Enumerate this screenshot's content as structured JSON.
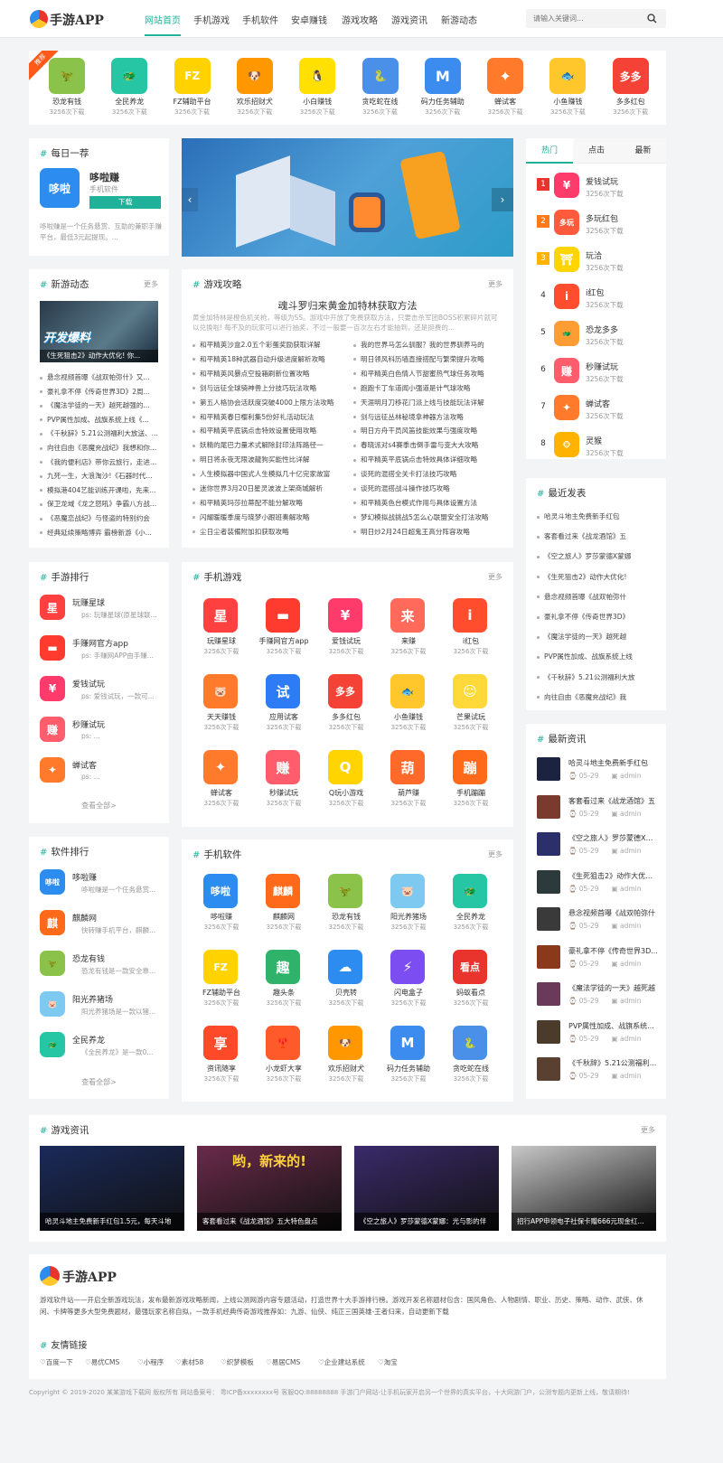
{
  "header": {
    "logo": "手游APP",
    "nav": [
      "网站首页",
      "手机游戏",
      "手机软件",
      "安卓赚钱",
      "游戏攻略",
      "游戏资讯",
      "新游动态"
    ],
    "search_placeholder": "请输入关键词...",
    "accent": "#1fb19a"
  },
  "top_apps": {
    "badge": "推荐",
    "items": [
      {
        "name": "恐龙有钱",
        "count": "3256次下载",
        "color": "#8bc34a",
        "glyph": "🦖"
      },
      {
        "name": "全民养龙",
        "count": "3256次下载",
        "color": "#26c6a5",
        "glyph": "🐲"
      },
      {
        "name": "FZ辅助平台",
        "count": "3256次下载",
        "color": "#ffd200",
        "glyph": "FZ"
      },
      {
        "name": "欢乐招财犬",
        "count": "3256次下载",
        "color": "#ff9800",
        "glyph": "🐶"
      },
      {
        "name": "小白赚钱",
        "count": "3256次下载",
        "color": "#ffe000",
        "glyph": "🐧"
      },
      {
        "name": "贪吃蛇在线",
        "count": "3256次下载",
        "color": "#4a8fe8",
        "glyph": "🐍"
      },
      {
        "name": "码力任务辅助",
        "count": "3256次下载",
        "color": "#3c8cf0",
        "glyph": "M"
      },
      {
        "name": "蝉试客",
        "count": "3256次下载",
        "color": "#ff7a2a",
        "glyph": "✦"
      },
      {
        "name": "小鱼赚钱",
        "count": "3256次下载",
        "color": "#ffc72c",
        "glyph": "🐟"
      },
      {
        "name": "多多红包",
        "count": "3256次下载",
        "color": "#f44336",
        "glyph": "多多"
      }
    ]
  },
  "daily": {
    "title": "每日一荐",
    "app_name": "哆啦赚",
    "app_type": "手机软件",
    "app_glyph": "哆啦",
    "download": "下载",
    "desc": "哆啦赚是一个任务悬赏、互助的兼职手赚平台，最低3元起提现。..."
  },
  "hot_tabs": [
    "热门",
    "点击",
    "最新"
  ],
  "hot_list": [
    {
      "rank": "1",
      "name": "爱钱试玩",
      "count": "3256次下载",
      "color": "#ff3b6b",
      "glyph": "¥"
    },
    {
      "rank": "2",
      "name": "多玩红包",
      "count": "3256次下载",
      "color": "#ff5a3c",
      "glyph": "多玩"
    },
    {
      "rank": "3",
      "name": "玩洽",
      "count": "3256次下载",
      "color": "#ffd400",
      "glyph": "⛩"
    },
    {
      "rank": "4",
      "name": "i红包",
      "count": "3256次下载",
      "color": "#ff4d2e",
      "glyph": "i"
    },
    {
      "rank": "5",
      "name": "恐龙多多",
      "count": "3256次下载",
      "color": "#ff9c33",
      "glyph": "🐲"
    },
    {
      "rank": "6",
      "name": "秒赚试玩",
      "count": "3256次下载",
      "color": "#ff5c6c",
      "glyph": "赚"
    },
    {
      "rank": "7",
      "name": "蝉试客",
      "count": "3256次下载",
      "color": "#ff7a2a",
      "glyph": "✦"
    },
    {
      "rank": "8",
      "name": "灵猴",
      "count": "3256次下载",
      "color": "#ffb300",
      "glyph": "🐵"
    }
  ],
  "news_dyn": {
    "title": "新游动态",
    "more": "更多",
    "img_caption": "《生死狙击2》动作大优化! 你...",
    "img_text": "开发爆料",
    "items": [
      "悬念视频首曝《战双帕弥什》又...",
      "豪礼拿不停《传奇世界3D》2周...",
      "《魔法学徒的一天》越死越强的...",
      "PVP属性加成、战旗系统上线《...",
      "《千秋辞》5.21公测福利大放送、...",
      "向往自由《恶魔充战纪》我想和你...",
      "《我的便利店》带你云旅行，走进...",
      "九死一生，大浪淘沙!《石器时代...",
      "模拟港404艺能训练开课啦，先来...",
      "保卫龙域《龙之怒吼》争霸八方战...",
      "《恶魔恋战纪》与怪盗的特别约会",
      "经典延续策略博弈 霸榜新游《小..."
    ]
  },
  "guides": {
    "title": "游戏攻略",
    "more": "更多",
    "headline": "魂斗罗归来黄金加特林获取方法",
    "summary": "黄金加特林是橙色机关枪，等级为SS。游戏中开放了免费获取方法，只要击杀军团BOSS积累碎片就可以兑换啦! 每不及的玩家可以进行抽奖，不过一般要一百次左右才能抽到，还是挺费的...",
    "left": [
      "和平精英沙盒2.0五个彩蛋奖励获取详解",
      "和平精英18种武器自动升级进度解析攻略",
      "和平精英风暴点空投箱刷新位置攻略",
      "剑与远征全球骑神兽上分技巧玩法攻略",
      "第五人格协会活跃度突破4000上限方法攻略",
      "和平精英春日樱利集5份好礼活动玩法",
      "和平精英平底锅点击特效设置使用攻略",
      "妖精的尾巴力量术式解除封印法阵路径一",
      "明日将永夜无限波龍狗买能性比详解",
      "人生模拟器中国式人生模拟几十亿完家故富",
      "迷你世界3月20日星灵波波上架商城解析",
      "和平精英玛莎拉蒂配不能分解攻略",
      "闪耀暖暖季度与晓梦小跟班奏解攻略",
      "尘日尘者装備附加扣获取攻略"
    ],
    "right": [
      "我的世界马怎么驯服？我的世界驯养马的",
      "明日领风科历墙直接搭配与繁荣提升攻略",
      "和平精英白色情人节甜蜜热气球任务攻略",
      "跑跑卡丁车道闻小强道是计气球攻略",
      "天涯明月刀移花门派上线与技能玩法详解",
      "剑与远征丛林秘境拿神器方法攻略",
      "明日方舟干员风笛技能效果与强度攻略",
      "春晓派对s4赛季击倒手雷与变大大攻略",
      "和平精英平底锅点击特效具体详细攻略",
      "谈死的混搭全关卡打法技巧攻略",
      "谈死的混搭战斗操作技巧攻略",
      "和平精英色台模式作用与具体设置方法",
      "梦幻模拟战挑战5怎么心联盟安全打法攻略",
      "明日炒2月24日超鬼王高分阵容攻略"
    ]
  },
  "latest": {
    "title": "最近发表",
    "items": [
      "哈灵斗地主免费新手红包",
      "客套看过来《战龙酒馆》五",
      "《空之旅人》罗莎蒙德X蒙娜",
      "《生死狙击2》动作大优化!",
      "悬念视频首曝《战双帕弥什",
      "豪礼拿不停《传奇世界3D》",
      "《魔法学徒的一天》越死越",
      "PVP属性加成、战旗系统上线",
      "《千秋辞》5.21公测福利大放",
      "向往自由《恶魔充战纪》我"
    ]
  },
  "news_info": {
    "title": "最新资讯",
    "items": [
      {
        "title": "哈灵斗地主免费新手红包",
        "date": "05-29",
        "author": "admin",
        "color": "#1b2340"
      },
      {
        "title": "客套看过来《战龙酒馆》五",
        "date": "05-29",
        "author": "admin",
        "color": "#7a3b2e"
      },
      {
        "title": "《空之旅人》罗莎蒙德X蒙...",
        "date": "05-29",
        "author": "admin",
        "color": "#2b2f6a"
      },
      {
        "title": "《生死狙击2》动作大优化...",
        "date": "05-29",
        "author": "admin",
        "color": "#2d3a3c"
      },
      {
        "title": "悬念视频首曝《战双帕弥什",
        "date": "05-29",
        "author": "admin",
        "color": "#3a3a3a"
      },
      {
        "title": "豪礼拿不停《传奇世界3D...",
        "date": "05-29",
        "author": "admin",
        "color": "#8a3a1a"
      },
      {
        "title": "《魔法学徒的一天》越死越",
        "date": "05-29",
        "author": "admin",
        "color": "#6a3a5a"
      },
      {
        "title": "PVP属性加成、战旗系统...",
        "date": "05-29",
        "author": "admin",
        "color": "#4a3b2a"
      },
      {
        "title": "《千秋辞》5.21公测福利...",
        "date": "05-29",
        "author": "admin",
        "color": "#5a4030"
      }
    ]
  },
  "game_rank": {
    "title": "手游排行",
    "view_all": "查看全部>",
    "items": [
      {
        "name": "玩赚星球",
        "ps": "ps: 玩赚星球(原星球联...",
        "color": "#ff4040",
        "glyph": "星"
      },
      {
        "name": "手赚网官方app",
        "ps": "ps: 手赚网APP由手赚...",
        "color": "#ff3b30",
        "glyph": "▬"
      },
      {
        "name": "爱钱试玩",
        "ps": "ps: 爱钱试玩，一款可...",
        "color": "#ff3b6b",
        "glyph": "¥"
      },
      {
        "name": "秒赚试玩",
        "ps": "ps: ...",
        "color": "#ff5c6c",
        "glyph": "赚"
      },
      {
        "name": "蝉试客",
        "ps": "ps: ...",
        "color": "#ff7a2a",
        "glyph": "✦"
      }
    ]
  },
  "phone_games": {
    "title": "手机游戏",
    "more": "更多",
    "items": [
      {
        "name": "玩赚星球",
        "count": "3256次下载",
        "color": "#ff4040",
        "glyph": "星"
      },
      {
        "name": "手赚网官方app",
        "count": "3256次下载",
        "color": "#ff3b30",
        "glyph": "▬"
      },
      {
        "name": "爱钱试玩",
        "count": "3256次下载",
        "color": "#ff3b6b",
        "glyph": "¥"
      },
      {
        "name": "来赚",
        "count": "3256次下载",
        "color": "#ff6a5a",
        "glyph": "来"
      },
      {
        "name": "i红包",
        "count": "3256次下载",
        "color": "#ff4d2e",
        "glyph": "i"
      },
      {
        "name": "天天赚钱",
        "count": "3256次下载",
        "color": "#ff7a2a",
        "glyph": "🐷"
      },
      {
        "name": "应用试客",
        "count": "3256次下载",
        "color": "#2d7cf6",
        "glyph": "试"
      },
      {
        "name": "多多红包",
        "count": "3256次下载",
        "color": "#f44336",
        "glyph": "多多"
      },
      {
        "name": "小鱼赚钱",
        "count": "3256次下载",
        "color": "#ffc72c",
        "glyph": "🐟"
      },
      {
        "name": "芒果试玩",
        "count": "3256次下载",
        "color": "#ffd93a",
        "glyph": "☺"
      },
      {
        "name": "蝉试客",
        "count": "3256次下载",
        "color": "#ff7a2a",
        "glyph": "✦"
      },
      {
        "name": "秒赚试玩",
        "count": "3256次下载",
        "color": "#ff5c6c",
        "glyph": "赚"
      },
      {
        "name": "Q玩小游戏",
        "count": "3256次下载",
        "color": "#ffd400",
        "glyph": "Q"
      },
      {
        "name": "葫芦赚",
        "count": "3256次下载",
        "color": "#ff6a2a",
        "glyph": "葫"
      },
      {
        "name": "手机蹦蹦",
        "count": "3256次下载",
        "color": "#ff6a1a",
        "glyph": "蹦"
      }
    ]
  },
  "soft_rank": {
    "title": "软件排行",
    "view_all": "查看全部>",
    "items": [
      {
        "name": "哆啦赚",
        "ps": "哆啦赚是一个任务悬赏...",
        "color": "#2d8cf0",
        "glyph": "哆啦"
      },
      {
        "name": "麒麟网",
        "ps": "快转赚手机平台，麒麟...",
        "color": "#ff6a1a",
        "glyph": "麒"
      },
      {
        "name": "恐龙有钱",
        "ps": "恐龙有钱是一款安全靠...",
        "color": "#8bc34a",
        "glyph": "🦖"
      },
      {
        "name": "阳光养猪场",
        "ps": "阳光养猪场是一款以猪...",
        "color": "#7ec9f0",
        "glyph": "🐷"
      },
      {
        "name": "全民养龙",
        "ps": "《全民养龙》是一款0...",
        "color": "#26c6a5",
        "glyph": "🐲"
      }
    ]
  },
  "phone_soft": {
    "title": "手机软件",
    "more": "更多",
    "items": [
      {
        "name": "哆啦赚",
        "count": "3256次下载",
        "color": "#2d8cf0",
        "glyph": "哆啦"
      },
      {
        "name": "麒麟网",
        "count": "3256次下载",
        "color": "#ff6a1a",
        "glyph": "麒麟"
      },
      {
        "name": "恐龙有钱",
        "count": "3256次下载",
        "color": "#8bc34a",
        "glyph": "🦖"
      },
      {
        "name": "阳光养猪场",
        "count": "3256次下载",
        "color": "#7ec9f0",
        "glyph": "🐷"
      },
      {
        "name": "全民养龙",
        "count": "3256次下载",
        "color": "#26c6a5",
        "glyph": "🐲"
      },
      {
        "name": "FZ辅助平台",
        "count": "3256次下载",
        "color": "#ffd200",
        "glyph": "FZ"
      },
      {
        "name": "趣头条",
        "count": "3256次下载",
        "color": "#2fb36a",
        "glyph": "趣"
      },
      {
        "name": "贝壳转",
        "count": "3256次下载",
        "color": "#2d8cf0",
        "glyph": "☁"
      },
      {
        "name": "闪电盒子",
        "count": "3256次下载",
        "color": "#7c4df0",
        "glyph": "⚡"
      },
      {
        "name": "蚂蚁看点",
        "count": "3256次下载",
        "color": "#e8342c",
        "glyph": "看点"
      },
      {
        "name": "资讯随享",
        "count": "3256次下载",
        "color": "#ff4a2a",
        "glyph": "享"
      },
      {
        "name": "小龙虾大享",
        "count": "3256次下载",
        "color": "#ff5a2a",
        "glyph": "🦞"
      },
      {
        "name": "欢乐招财犬",
        "count": "3256次下载",
        "color": "#ff9800",
        "glyph": "🐶"
      },
      {
        "name": "码力任务辅助",
        "count": "3256次下载",
        "color": "#3c8cf0",
        "glyph": "M"
      },
      {
        "name": "贪吃蛇在线",
        "count": "3256次下载",
        "color": "#4a8fe8",
        "glyph": "🐍"
      }
    ]
  },
  "game_news": {
    "title": "游戏资讯",
    "more": "更多",
    "items": [
      {
        "caption": "哈灵斗地主免费新手红包1.5元，每天斗地",
        "color": "#1a2a5a"
      },
      {
        "caption": "客套看过来《战龙酒馆》五大特色盘点",
        "color": "#6a2a4a",
        "banner": "哟，新来的!"
      },
      {
        "caption": "《空之旅人》罗莎蒙德X蒙娜：光与影的伴",
        "color": "#3a2a6a"
      },
      {
        "caption": "招行APP申领电子社保卡赠666元现金红...",
        "color": "#c8c8c8"
      }
    ]
  },
  "footer": {
    "logo": "手游APP",
    "desc": "游戏软件站——开启全新游戏玩法，发布最新游戏攻略新闻，上线公测网游内容专题活动，打造世界十大手游排行榜。游戏开发名称题材包含：国风角色、人物剧情、职业、历史、策略、动作、武侠、休闲、卡牌等更多大型免费题材，最强玩家名称自拟，一款手机经典传奇游戏推荐如：九游、仙侠、纯正三国英雄-王者归来，自动更新下载",
    "links_title": "友情链接",
    "links": [
      "百度一下",
      "易优CMS",
      "小程序",
      "素材58",
      "织梦模板",
      "易居CMS",
      "企业建站系统",
      "淘宝"
    ],
    "copyright": "Copyright © 2019-2020 某某游戏下载网 版权所有 网站备案号：  粤ICP备xxxxxxxx号    客服QQ:88888888 手游门户网站-让手机玩家开启另一个世界的真实平台，十大网游门户，公测专题内更新上线，敬请期待!"
  }
}
